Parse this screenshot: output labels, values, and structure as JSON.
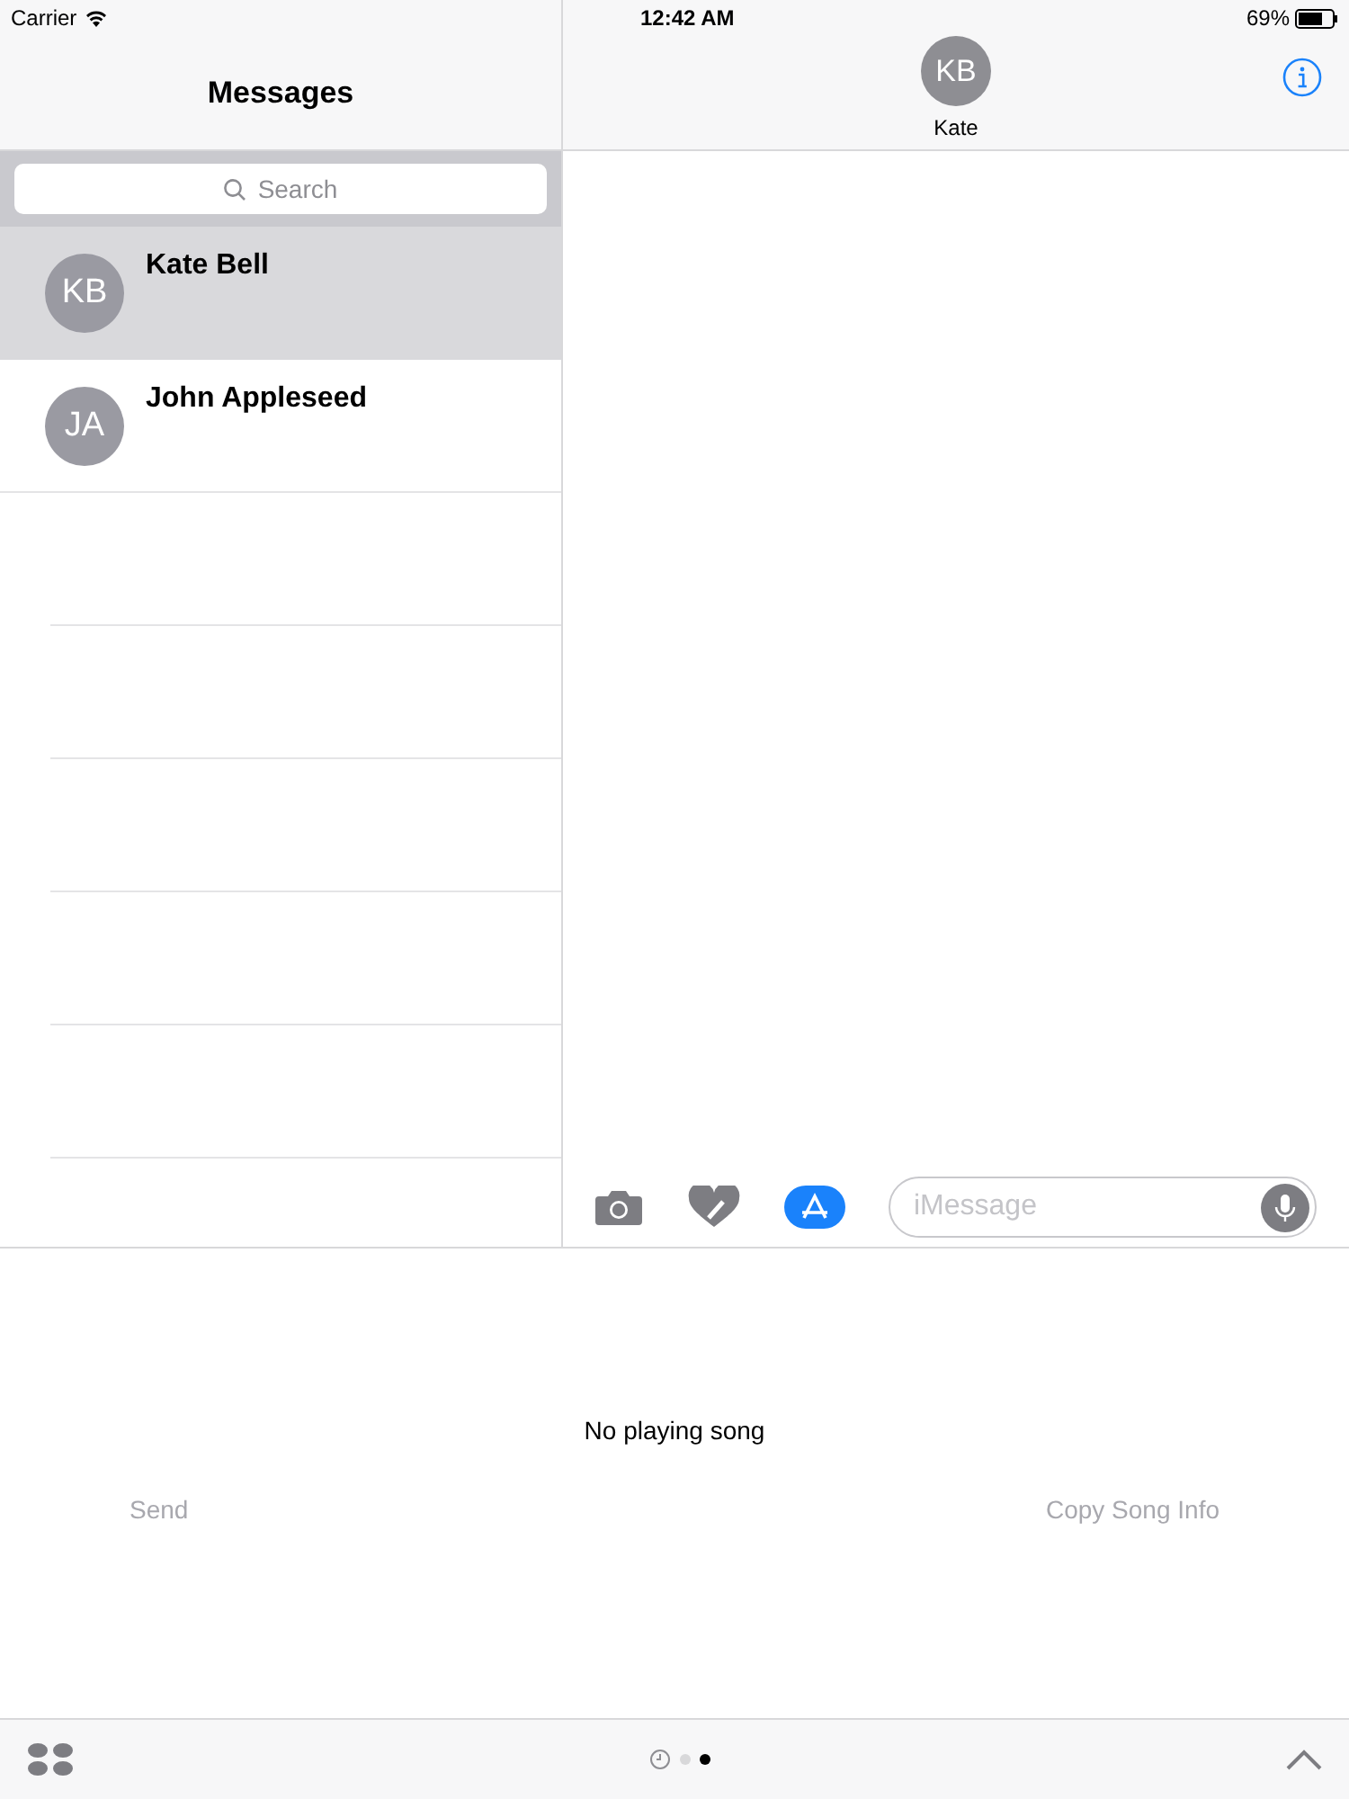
{
  "status_bar": {
    "carrier": "Carrier",
    "time": "12:42 AM",
    "battery": "69%"
  },
  "sidebar": {
    "title": "Messages",
    "search": {
      "placeholder": "Search"
    },
    "conversations": [
      {
        "initials": "KB",
        "name": "Kate Bell",
        "selected": true
      },
      {
        "initials": "JA",
        "name": "John Appleseed",
        "selected": false
      }
    ]
  },
  "conversation": {
    "initials": "KB",
    "name": "Kate",
    "input": {
      "placeholder": "iMessage"
    }
  },
  "extension": {
    "message": "No playing song",
    "buttons": [
      {
        "label": "Send",
        "disabled": true
      },
      {
        "label": "Copy Song Info",
        "disabled": true
      }
    ]
  },
  "pages": [
    {
      "kind": "recents",
      "selected": false
    },
    {
      "kind": "dot",
      "selected": false
    },
    {
      "kind": "dot",
      "selected": true
    }
  ]
}
